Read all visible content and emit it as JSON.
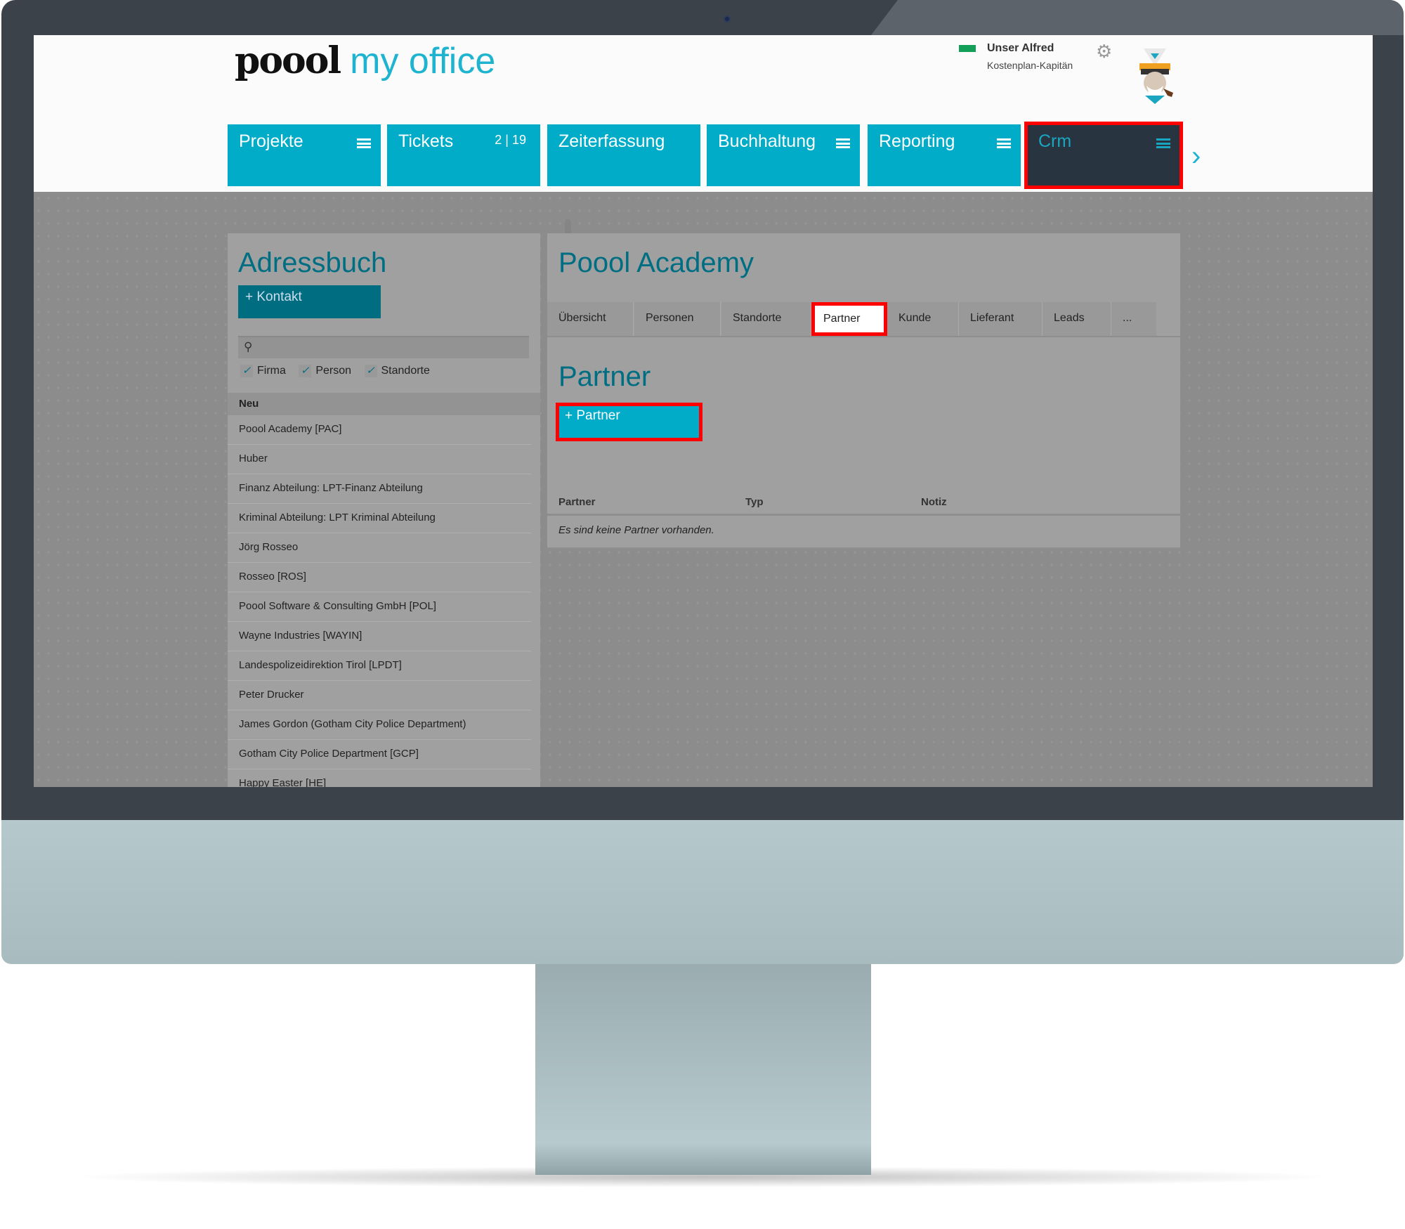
{
  "app": {
    "logo_brand": "poool",
    "logo_product": "my office"
  },
  "user": {
    "name": "Unser Alfred",
    "role": "Kostenplan-Kapitän",
    "status_color": "#12a058"
  },
  "nav": {
    "items": [
      {
        "label": "Projekte",
        "has_menu": true
      },
      {
        "label": "Tickets",
        "count": "2 | 19"
      },
      {
        "label": "Zeiterfassung"
      },
      {
        "label": "Buchhaltung",
        "has_menu": true
      },
      {
        "label": "Reporting",
        "has_menu": true
      },
      {
        "label": "Crm",
        "has_menu": true,
        "active": true
      }
    ]
  },
  "addressbook": {
    "title": "Adressbuch",
    "add_label": "Kontakt",
    "search_placeholder": "",
    "filters": [
      {
        "label": "Firma",
        "checked": true
      },
      {
        "label": "Person",
        "checked": true
      },
      {
        "label": "Standorte",
        "checked": true
      }
    ],
    "section": "Neu",
    "items": [
      "Poool Academy [PAC]",
      "Huber",
      "Finanz Abteilung: LPT-Finanz Abteilung",
      "Kriminal Abteilung: LPT Kriminal Abteilung",
      "Jörg Rosseo",
      "Rosseo [ROS]",
      "Poool Software & Consulting GmbH [POL]",
      "Wayne Industries [WAYIN]",
      "Landespolizeidirektion Tirol [LPDT]",
      "Peter Drucker",
      "James Gordon (Gotham City Police Department)",
      "Gotham City Police Department [GCP]",
      "Happy Easter [HE]"
    ]
  },
  "detail": {
    "title": "Poool Academy",
    "tabs": [
      "Übersicht",
      "Personen",
      "Standorte",
      "Partner",
      "Kunde",
      "Lieferant",
      "Leads",
      "..."
    ],
    "active_tab": "Partner",
    "section_title": "Partner",
    "add_label": "Partner",
    "columns": [
      "Partner",
      "Typ",
      "Notiz"
    ],
    "empty_text": "Es sind keine Partner vorhanden."
  },
  "colors": {
    "accent": "#00acc8",
    "dark": "#283440",
    "highlight": "#ff0000",
    "button_dark": "#006e80"
  }
}
